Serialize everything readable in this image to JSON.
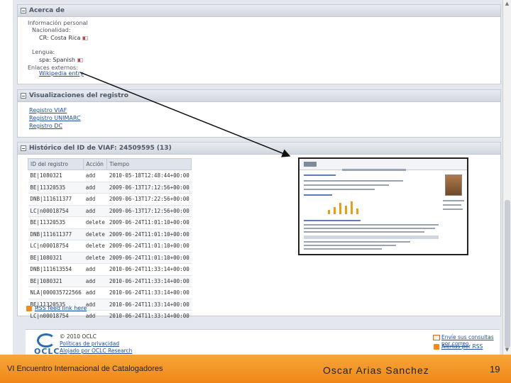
{
  "about": {
    "title": "Acerca de",
    "personal_info_label": "Información personal",
    "nationality_label": "Nacionalidad:",
    "nationality_value": "CR: Costa Rica",
    "language_label": "Lengua:",
    "language_value": "spa: Spanish",
    "external_links_label": "Enlaces externos:",
    "external_link": "Wikipedia entry"
  },
  "record_views": {
    "title": "Visualizaciones del registro",
    "links": [
      "Registro VIAF",
      "Registro UNIMARC",
      "Registro DC"
    ]
  },
  "history": {
    "title": "Histórico del ID de VIAF: 24509595 (13)",
    "columns": [
      "ID del registro",
      "Acción",
      "Tiempo"
    ],
    "rows": [
      [
        "BE|1080321",
        "add",
        "2010-05-18T12:48:44+00:00"
      ],
      [
        "BE|11320535",
        "add",
        "2009-06-13T17:12:56+00:00"
      ],
      [
        "DNB|111611377",
        "add",
        "2009-06-13T17:22:56+00:00"
      ],
      [
        "LC|n00018754",
        "add",
        "2009-06-13T17:12:56+00:00"
      ],
      [
        "BE|11320535",
        "delete",
        "2009-06-24T11:01:10+00:00"
      ],
      [
        "DNB|111611377",
        "delete",
        "2009-06-24T11:01:10+00:00"
      ],
      [
        "LC|n00018754",
        "delete",
        "2009-06-24T11:01:10+00:00"
      ],
      [
        "BE|1080321",
        "delete",
        "2009-06-24T11:01:10+00:00"
      ],
      [
        "DNB|111613554",
        "add",
        "2010-06-24T11:33:14+00:00"
      ],
      [
        "BE|1080321",
        "add",
        "2010-06-24T11:33:14+00:00"
      ],
      [
        "NLA|000035722566",
        "add",
        "2010-06-24T11:33:14+00:00"
      ],
      [
        "BE|11320535",
        "add",
        "2010-06-24T11:33:14+00:00"
      ],
      [
        "LC|n00018754",
        "add",
        "2010-06-24T11:33:14+00:00"
      ]
    ],
    "feed_link": "RSS feed link here"
  },
  "page_footer": {
    "copyright": "© 2010 OCLC",
    "privacy_link": "Políticas de privacidad",
    "hosted_by_link": "Alojado por OCLC Research",
    "logo_text": "OCLC",
    "contact_link": "Envíe sus consultas por correo",
    "feed_link": "Alertas por RSS"
  },
  "slide_footer": {
    "event": "VI Encuentro Internacional de Catalogadores",
    "author": "Oscar Arias Sanchez",
    "page_number": "19"
  }
}
